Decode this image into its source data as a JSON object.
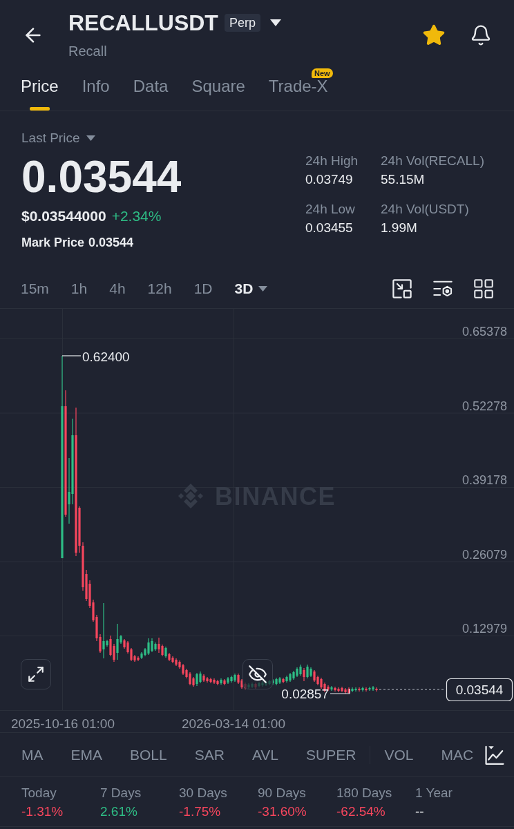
{
  "header": {
    "symbol": "RECALLUSDT",
    "contract_badge": "Perp",
    "name": "Recall",
    "favorited": true
  },
  "tabs": [
    {
      "label": "Price",
      "selected": true
    },
    {
      "label": "Info",
      "selected": false
    },
    {
      "label": "Data",
      "selected": false
    },
    {
      "label": "Square",
      "selected": false
    },
    {
      "label": "Trade-X",
      "selected": false,
      "badge": "New"
    }
  ],
  "price": {
    "selector_label": "Last Price",
    "last": "0.03544",
    "usd": "$0.03544000",
    "change": {
      "text": "+2.34%",
      "color": "#2ebd85"
    },
    "mark_label": "Mark Price",
    "mark_value": "0.03544"
  },
  "stats_24h": [
    {
      "label": "24h High",
      "value": "0.03749"
    },
    {
      "label": "24h Vol(RECALL)",
      "value": "55.15M"
    },
    {
      "label": "24h Low",
      "value": "0.03455"
    },
    {
      "label": "24h Vol(USDT)",
      "value": "1.99M"
    }
  ],
  "intervals": [
    {
      "label": "15m",
      "selected": false,
      "dropdown": false
    },
    {
      "label": "1h",
      "selected": false,
      "dropdown": false
    },
    {
      "label": "4h",
      "selected": false,
      "dropdown": false
    },
    {
      "label": "12h",
      "selected": false,
      "dropdown": false
    },
    {
      "label": "1D",
      "selected": false,
      "dropdown": false
    },
    {
      "label": "3D",
      "selected": true,
      "dropdown": true
    }
  ],
  "chart": {
    "watermark": "BINANCE",
    "y_labels": [
      "0.65378",
      "0.52278",
      "0.39178",
      "0.26079",
      "0.12979"
    ],
    "x_labels": [
      "2025-10-16 01:00",
      "2026-03-14 01:00"
    ],
    "high_marker": "0.62400",
    "low_marker": "0.02857",
    "last_price_tag": "0.03544"
  },
  "indicators": {
    "main": [
      "MA",
      "EMA",
      "BOLL",
      "SAR",
      "AVL",
      "SUPER"
    ],
    "sub": [
      "VOL",
      "MAC"
    ]
  },
  "performance": [
    {
      "label": "Today",
      "value": "-1.31%",
      "color": "#f6465d"
    },
    {
      "label": "7 Days",
      "value": "2.61%",
      "color": "#2ebd85"
    },
    {
      "label": "30 Days",
      "value": "-1.75%",
      "color": "#f6465d"
    },
    {
      "label": "90 Days",
      "value": "-31.60%",
      "color": "#f6465d"
    },
    {
      "label": "180 Days",
      "value": "-62.54%",
      "color": "#f6465d"
    },
    {
      "label": "1 Year",
      "value": "--",
      "color": "#eaecef"
    }
  ]
}
